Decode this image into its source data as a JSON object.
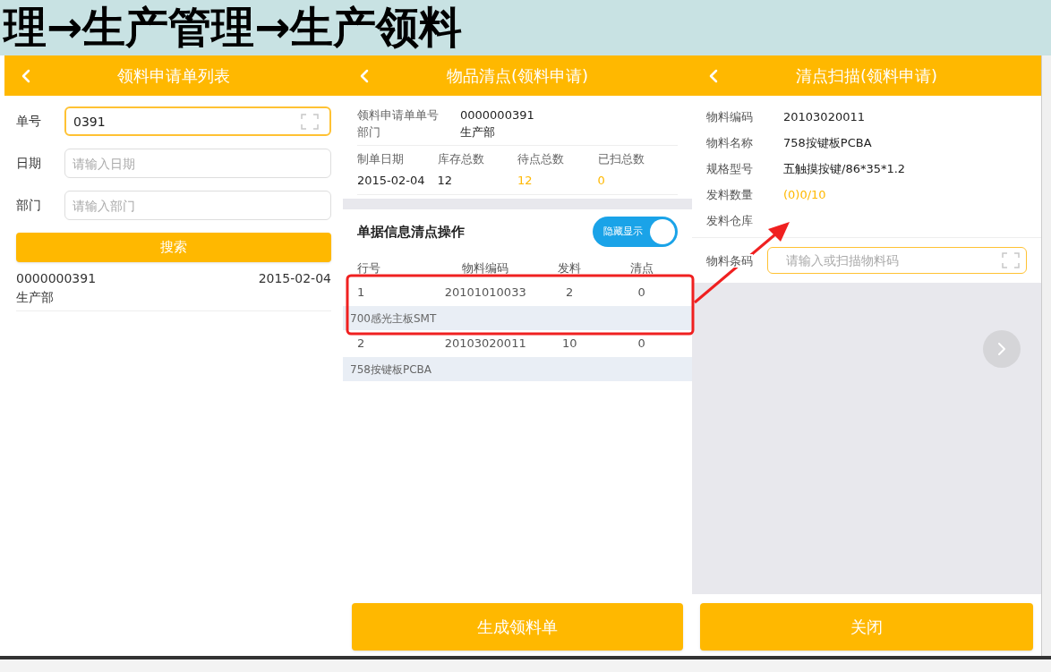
{
  "breadcrumb": "理→生产管理→生产领料",
  "list_screen": {
    "title": "领料申请单列表",
    "fields": [
      {
        "label": "单号",
        "value": "0391",
        "focused": true,
        "scannable": true
      },
      {
        "label": "日期",
        "placeholder": "请输入日期",
        "focused": false,
        "scannable": false
      },
      {
        "label": "部门",
        "placeholder": "请输入部门",
        "focused": false,
        "scannable": false
      }
    ],
    "search_button": "搜索",
    "results": [
      {
        "number": "0000000391",
        "date": "2015-02-04",
        "department": "生产部"
      }
    ]
  },
  "count_screen": {
    "title": "物品清点(领料申请)",
    "header_fields": [
      {
        "label": "领料申请单单号",
        "value": "0000000391"
      },
      {
        "label": "部门",
        "value": "生产部"
      }
    ],
    "stats": [
      {
        "label": "制单日期",
        "value": "2015-02-04",
        "highlight": false
      },
      {
        "label": "库存总数",
        "value": "12",
        "highlight": false
      },
      {
        "label": "待点总数",
        "value": "12",
        "highlight": true
      },
      {
        "label": "已扫总数",
        "value": "0",
        "highlight": true
      }
    ],
    "section_title": "单据信息清点操作",
    "toggle": {
      "label": "隐藏显示",
      "on": true
    },
    "table": {
      "columns": [
        "行号",
        "物料编码",
        "发料",
        "清点"
      ],
      "rows": [
        {
          "cells": [
            "1",
            "20101010033",
            "2",
            "0"
          ],
          "name": "700感光主板SMT"
        },
        {
          "cells": [
            "2",
            "20103020011",
            "10",
            "0"
          ],
          "name": "758按键板PCBA"
        }
      ]
    },
    "button": "生成领料单"
  },
  "scan_screen": {
    "title": "清点扫描(领料申请)",
    "details": [
      {
        "label": "物料编码",
        "value": "20103020011"
      },
      {
        "label": "物料名称",
        "value": "758按键板PCBA"
      },
      {
        "label": "规格型号",
        "value": "五触摸按键/86*35*1.2"
      },
      {
        "label": "发料数量",
        "value": "(0)0/10",
        "highlight": true
      },
      {
        "label": "发料仓库"
      }
    ],
    "barcode": {
      "label": "物料条码",
      "placeholder": "请输入或扫描物料码"
    },
    "button": "关闭"
  }
}
